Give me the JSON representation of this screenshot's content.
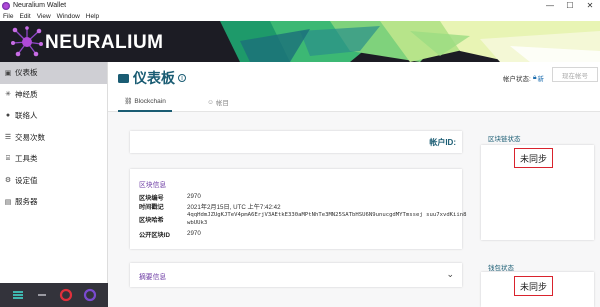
{
  "window": {
    "title": "Neuralium Wallet",
    "controls": [
      "—",
      "☐",
      "✕"
    ]
  },
  "menu": [
    "File",
    "Edit",
    "View",
    "Window",
    "Help"
  ],
  "brand": {
    "logo_text": "NEURALIUM",
    "accent": "#1a5c73",
    "purple": "#6b3aa3"
  },
  "sidebar": {
    "items": [
      {
        "label": "仪表板",
        "icon": "dashboard-icon",
        "glyph": "▣"
      },
      {
        "label": "神经质",
        "icon": "neuron-icon",
        "glyph": "✳"
      },
      {
        "label": "联络人",
        "icon": "contacts-icon",
        "glyph": "●"
      },
      {
        "label": "交易次数",
        "icon": "transactions-icon",
        "glyph": "☰"
      },
      {
        "label": "工具类",
        "icon": "tools-icon",
        "glyph": "⌸"
      },
      {
        "label": "设定值",
        "icon": "settings-icon",
        "glyph": "⚙"
      },
      {
        "label": "服务器",
        "icon": "server-icon",
        "glyph": "▤"
      }
    ]
  },
  "page": {
    "title": "仪表板",
    "account_state_label": "帐户状态:",
    "account_state_value": "新",
    "create_account_button": "现在帐号"
  },
  "tabs": [
    {
      "label": "Blockchain",
      "icon": "link-icon",
      "glyph": "⛓"
    },
    {
      "label": "帐目",
      "icon": "account-icon",
      "glyph": "☺"
    }
  ],
  "account_card": {
    "label": "帐户ID:"
  },
  "block_info": {
    "title": "区块信息",
    "rows": [
      {
        "key": "区块编号",
        "value": "2970"
      },
      {
        "key": "时间戳记",
        "value": "2021年2月15日, UTC 上午7:42:42"
      },
      {
        "key": "区块哈希",
        "value": "4qqHdmJZUgKJTeV4pmA6ErjV3AEtkE330aMPtNhTe3MN25SATbHSU6N9unucgdMYTmssej suu7xvdKiin8wbUUk3"
      },
      {
        "key": "公开区块ID",
        "value": "2970"
      }
    ]
  },
  "summary": {
    "title": "摘要信息"
  },
  "chain_status": {
    "title": "区块链状态",
    "value": "未同步"
  },
  "wallet_status": {
    "title": "钱包状态",
    "value": "未同步"
  }
}
